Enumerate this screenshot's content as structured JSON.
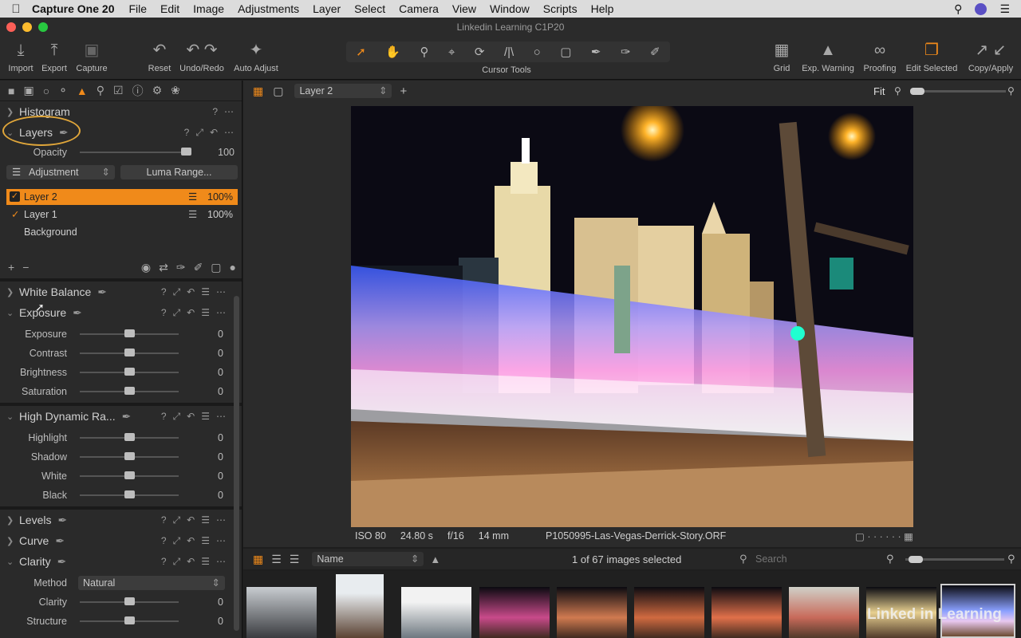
{
  "menubar": {
    "app": "Capture One 20",
    "items": [
      "File",
      "Edit",
      "Image",
      "Adjustments",
      "Layer",
      "Select",
      "Camera",
      "View",
      "Window",
      "Scripts",
      "Help"
    ]
  },
  "window": {
    "title": "Linkedin Learning C1P20"
  },
  "toolbar": {
    "left": [
      {
        "label": "Import",
        "icon": "import-icon"
      },
      {
        "label": "Export",
        "icon": "export-icon"
      },
      {
        "label": "Capture",
        "icon": "camera-icon"
      },
      {
        "label": "Reset",
        "icon": "reset-icon"
      },
      {
        "label": "Undo/Redo",
        "icon": "undo-redo-icon"
      },
      {
        "label": "Auto Adjust",
        "icon": "magic-wand-icon"
      }
    ],
    "cursor_tools_label": "Cursor Tools",
    "right": [
      {
        "label": "Grid",
        "icon": "grid-icon"
      },
      {
        "label": "Exp. Warning",
        "icon": "warning-icon"
      },
      {
        "label": "Proofing",
        "icon": "glasses-icon"
      },
      {
        "label": "Edit Selected",
        "icon": "edit-selected-icon"
      },
      {
        "label": "Copy/Apply",
        "icon": "copy-apply-icon"
      }
    ]
  },
  "left": {
    "histogram": "Histogram",
    "layers": {
      "title": "Layers",
      "opacity_label": "Opacity",
      "opacity_value": "100",
      "opacity": 1.0,
      "adjustment": "Adjustment",
      "luma": "Luma Range...",
      "items": [
        {
          "name": "Layer 2",
          "pct": "100%"
        },
        {
          "name": "Layer 1",
          "pct": "100%"
        },
        {
          "name": "Background",
          "pct": ""
        }
      ]
    },
    "white_balance": "White Balance",
    "exposure": {
      "title": "Exposure",
      "rows": [
        {
          "label": "Exposure",
          "value": "0"
        },
        {
          "label": "Contrast",
          "value": "0"
        },
        {
          "label": "Brightness",
          "value": "0"
        },
        {
          "label": "Saturation",
          "value": "0"
        }
      ]
    },
    "hdr": {
      "title": "High Dynamic Ra...",
      "rows": [
        {
          "label": "Highlight",
          "value": "0"
        },
        {
          "label": "Shadow",
          "value": "0"
        },
        {
          "label": "White",
          "value": "0"
        },
        {
          "label": "Black",
          "value": "0"
        }
      ]
    },
    "levels": "Levels",
    "curve": "Curve",
    "clarity": {
      "title": "Clarity",
      "method_label": "Method",
      "method": "Natural",
      "rows": [
        {
          "label": "Clarity",
          "value": "0"
        },
        {
          "label": "Structure",
          "value": "0"
        }
      ]
    }
  },
  "viewer": {
    "layer_select": "Layer 2",
    "fit": "Fit",
    "iso": "ISO 80",
    "shutter": "24.80 s",
    "aperture": "f/16",
    "focal": "14 mm",
    "filename": "P1050995-Las-Vegas-Derrick-Story.ORF"
  },
  "browser": {
    "sort": "Name",
    "count": "1 of 67 images selected",
    "search_placeholder": "Search",
    "watermark": "Linked in Learning"
  }
}
